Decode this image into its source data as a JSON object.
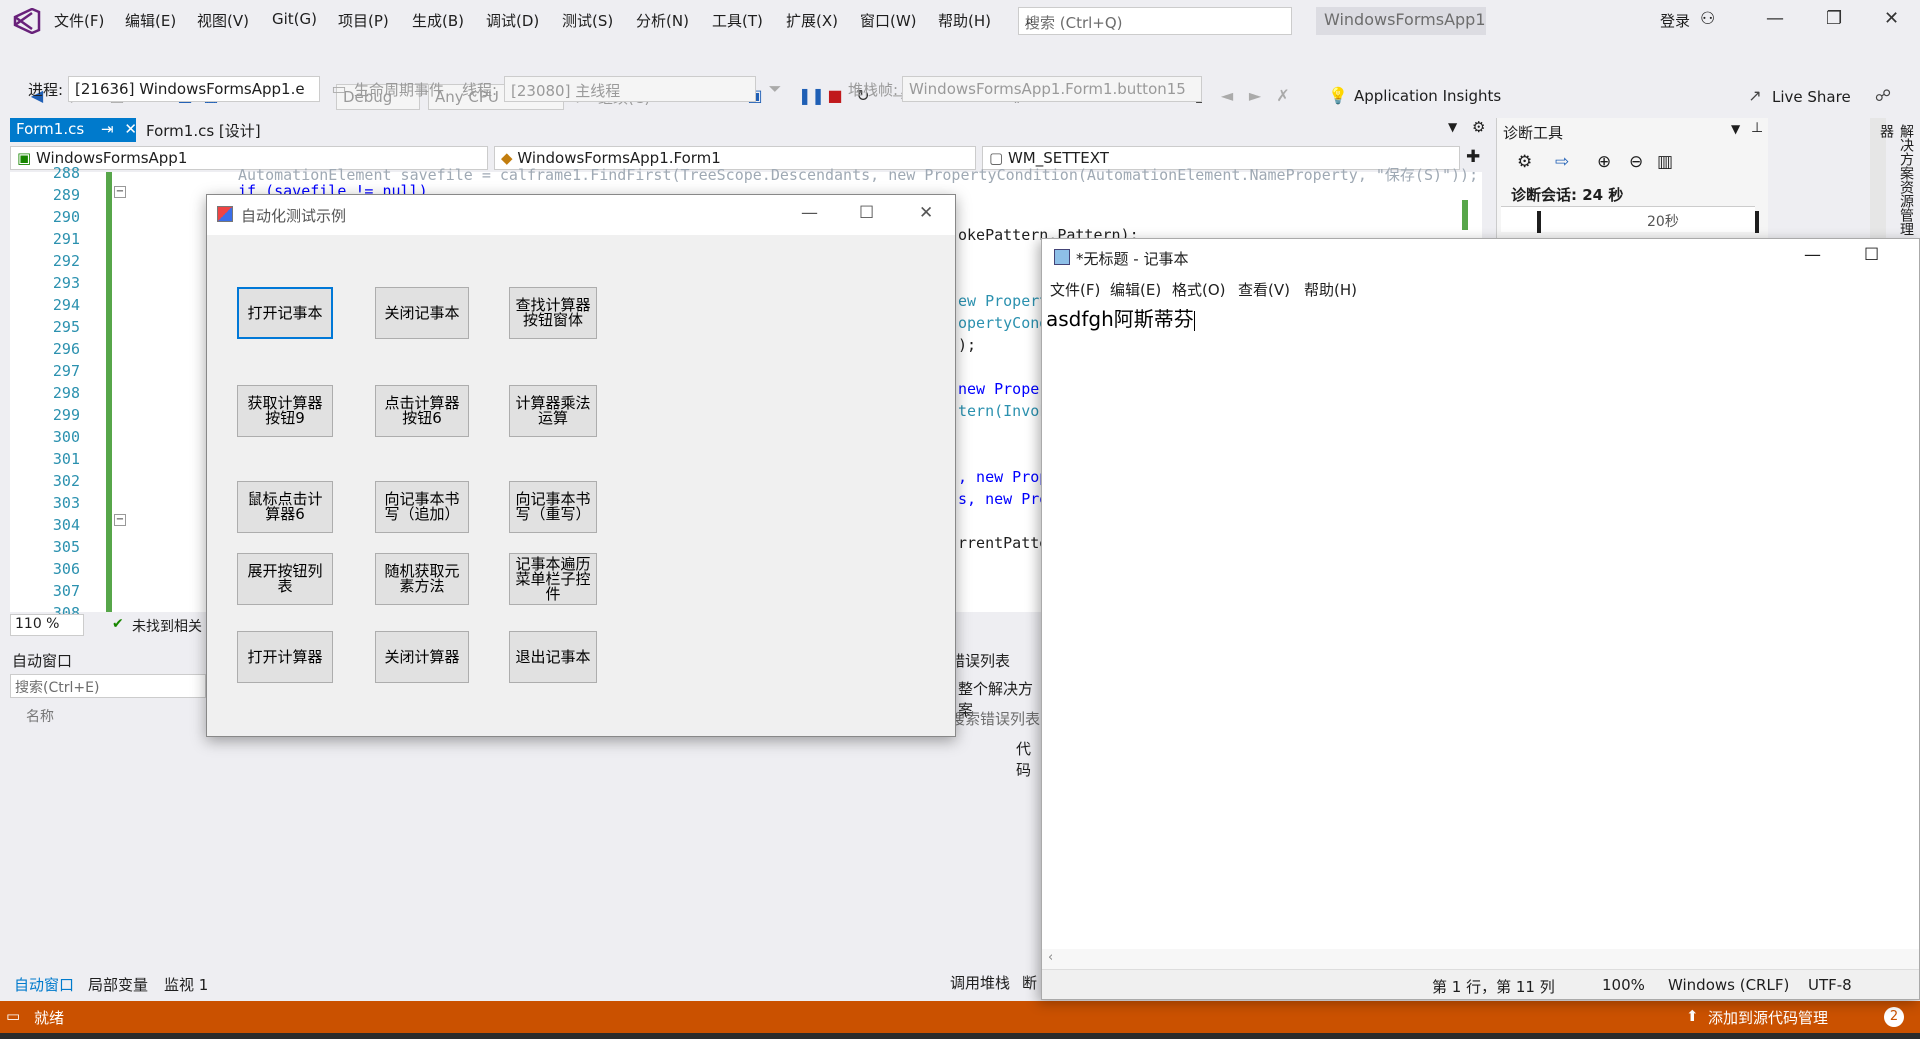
{
  "menubar": {
    "items": [
      "文件(F)",
      "编辑(E)",
      "视图(V)",
      "Git(G)",
      "项目(P)",
      "生成(B)",
      "调试(D)",
      "测试(S)",
      "分析(N)",
      "工具(T)",
      "扩展(X)",
      "窗口(W)",
      "帮助(H)"
    ],
    "search_placeholder": "搜索 (Ctrl+Q)",
    "solution_badge": "WindowsFormsApp1",
    "login": "登录"
  },
  "toolbar1": {
    "config": "Debug",
    "platform": "Any CPU",
    "continue": "继续(C)",
    "app_insights": "Application Insights",
    "live_share": "Live Share"
  },
  "toolbar2": {
    "process_label": "进程:",
    "process_value": "[21636] WindowsFormsApp1.e",
    "lifecycle": "生命周期事件",
    "thread_label": "线程:",
    "thread_value": "[23080] 主线程",
    "stack_label": "堆栈帧:",
    "stack_value": "WindowsFormsApp1.Form1.button15"
  },
  "doc_tabs": [
    {
      "label": "Form1.cs"
    },
    {
      "label": "Form1.cs [设计]"
    }
  ],
  "nav": {
    "project": "WindowsFormsApp1",
    "type": "WindowsFormsApp1.Form1",
    "member": "WM_SETTEXT"
  },
  "editor": {
    "line_numbers": [
      "288",
      "289",
      "290",
      "291",
      "292",
      "293",
      "294",
      "295",
      "296",
      "297",
      "298",
      "299",
      "300",
      "301",
      "302",
      "303",
      "304",
      "305",
      "306",
      "307",
      "308"
    ],
    "frag_top": "AutomationElement savefile = calframe1.FindFirst(TreeScope.Descendants, new PropertyCondition(AutomationElement.NameProperty, \"保存(S)\"));",
    "frag_if": "if (savefile != null)",
    "frag_1": "okePattern.Pattern);",
    "frag_2": "ew Propert",
    "frag_3": "opertyCond",
    "frag_4": ");",
    "frag_5": "new Prope",
    "frag_6": "tern(Invok",
    "frag_7": ", new Prop",
    "frag_8": "s, new Pro",
    "frag_9": "rrentPatte",
    "zoom": "110 %",
    "issues": "未找到相关"
  },
  "diag": {
    "title": "诊断工具",
    "session": "诊断会话: 24 秒",
    "tick": "20秒",
    "side_tab": "解决方案资源管理器"
  },
  "bottom": {
    "auto_title": "自动窗口",
    "search_placeholder": "搜索(Ctrl+E)",
    "col_name": "名称",
    "tabs": [
      "自动窗口",
      "局部变量",
      "监视 1"
    ],
    "err_title": "错误列表",
    "err_scope": "整个解决方案",
    "err_search": "搜索错误列表",
    "err_col": "代码",
    "bottom_tabs": [
      "调用堆栈",
      "断"
    ]
  },
  "form": {
    "title": "自动化测试示例",
    "buttons": [
      "打开记事本",
      "关闭记事本",
      "查找计算器按钮窗体",
      "获取计算器按钮9",
      "点击计算器按钮6",
      "计算器乘法运算",
      "鼠标点击计算器6",
      "向记事本书写（追加）",
      "向记事本书写（重写）",
      "展开按钮列表",
      "随机获取元素方法",
      "记事本遍历菜单栏子控件",
      "打开计算器",
      "关闭计算器",
      "退出记事本"
    ]
  },
  "notepad": {
    "title": "*无标题 - 记事本",
    "menu": [
      "文件(F)",
      "编辑(E)",
      "格式(O)",
      "查看(V)",
      "帮助(H)"
    ],
    "text": "asdfgh阿斯蒂芬",
    "status_pos": "第 1 行，第 11 列",
    "status_zoom": "100%",
    "status_eol": "Windows (CRLF)",
    "status_enc": "UTF-8"
  },
  "statusbar": {
    "ready": "就绪",
    "source_control": "添加到源代码管理",
    "badge": "2"
  },
  "colors": {
    "accent": "#007acc",
    "statusbar": "#ca5100",
    "line_numbers": "#2b91af"
  }
}
